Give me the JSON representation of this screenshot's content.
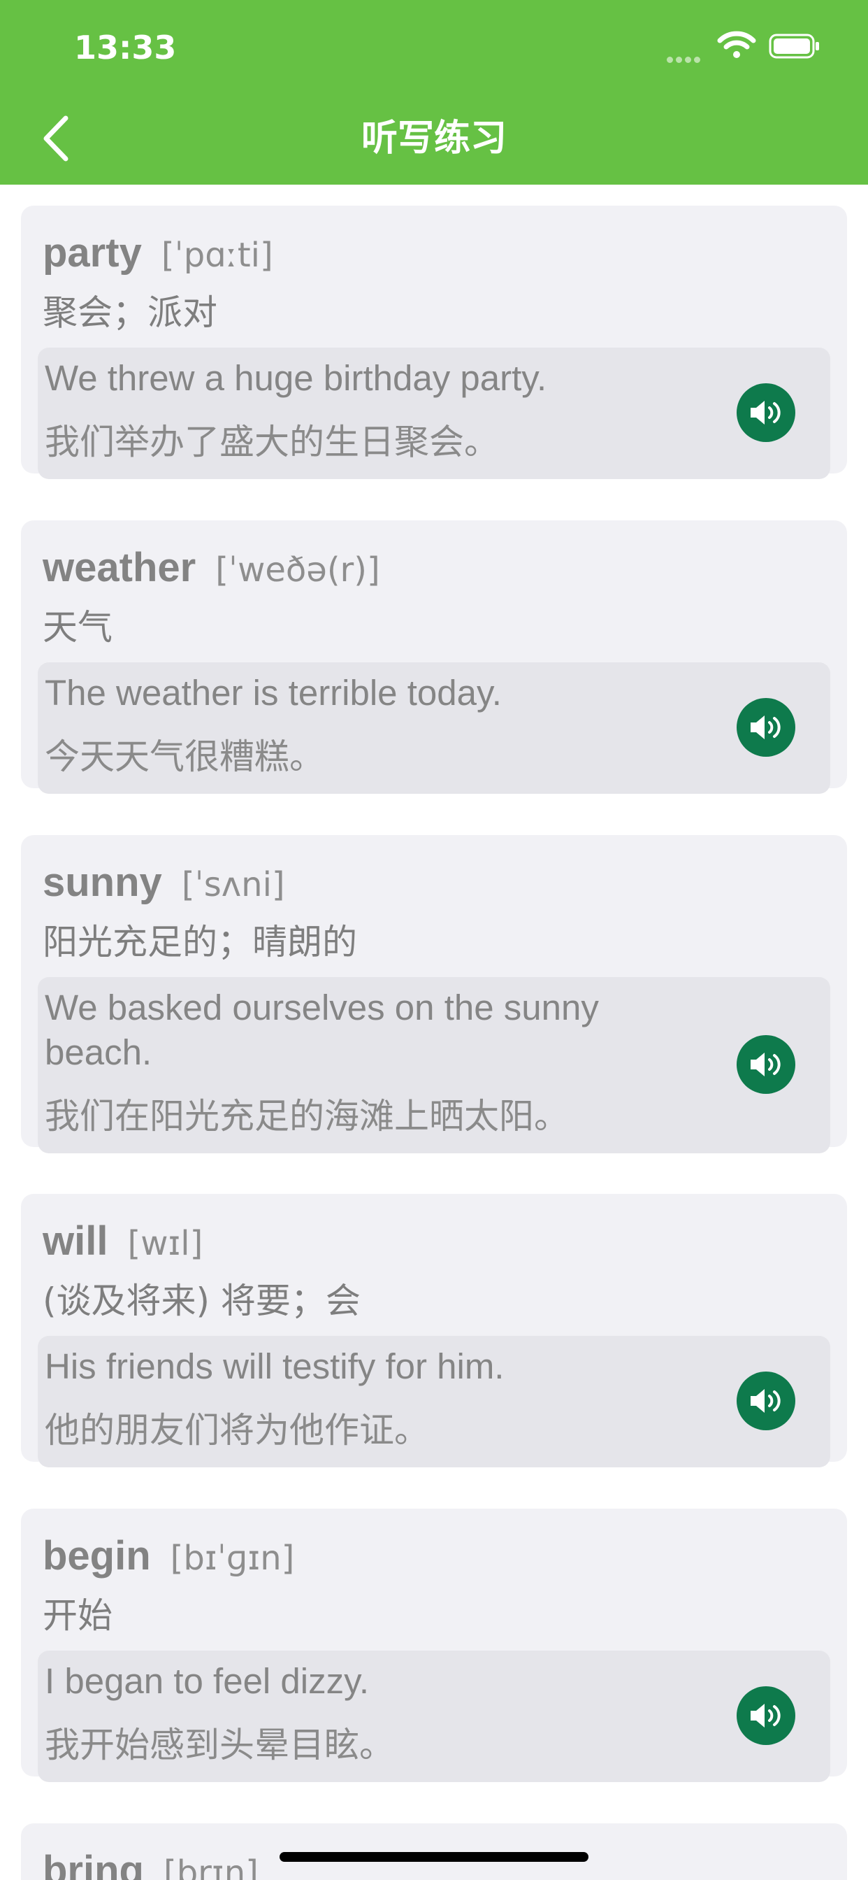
{
  "status_bar": {
    "time": "13:33"
  },
  "nav": {
    "title": "听写练习"
  },
  "words": [
    {
      "word": "party",
      "phonetic": "[ˈpɑːti]",
      "meaning": "聚会；派对",
      "example_en": "We threw a huge birthday party.",
      "example_zh": "我们举办了盛大的生日聚会。"
    },
    {
      "word": "weather",
      "phonetic": "[ˈweðə(r)]",
      "meaning": "天气",
      "example_en": "The weather is terrible today.",
      "example_zh": "今天天气很糟糕。"
    },
    {
      "word": "sunny",
      "phonetic": "[ˈsʌni]",
      "meaning": "阳光充足的；晴朗的",
      "example_en": "We basked ourselves on the sunny beach.",
      "example_zh": "我们在阳光充足的海滩上晒太阳。"
    },
    {
      "word": "will",
      "phonetic": "[wɪl]",
      "meaning": "(谈及将来) 将要；会",
      "example_en": "His friends will testify for him.",
      "example_zh": "他的朋友们将为他作证。"
    },
    {
      "word": "begin",
      "phonetic": "[bɪˈɡɪn]",
      "meaning": "开始",
      "example_en": "I began to feel dizzy.",
      "example_zh": "我开始感到头晕目眩。"
    },
    {
      "word": "bring",
      "phonetic": "[brɪŋ]"
    }
  ],
  "colors": {
    "header": "#66c144",
    "card": "#f1f1f5",
    "example_box": "#e5e5ea",
    "speaker_button": "#0e7a4c"
  },
  "icons": {
    "back": "chevron-left-icon",
    "speaker": "speaker-icon",
    "wifi": "wifi-icon",
    "battery": "battery-icon",
    "signal": "signal-icon"
  }
}
